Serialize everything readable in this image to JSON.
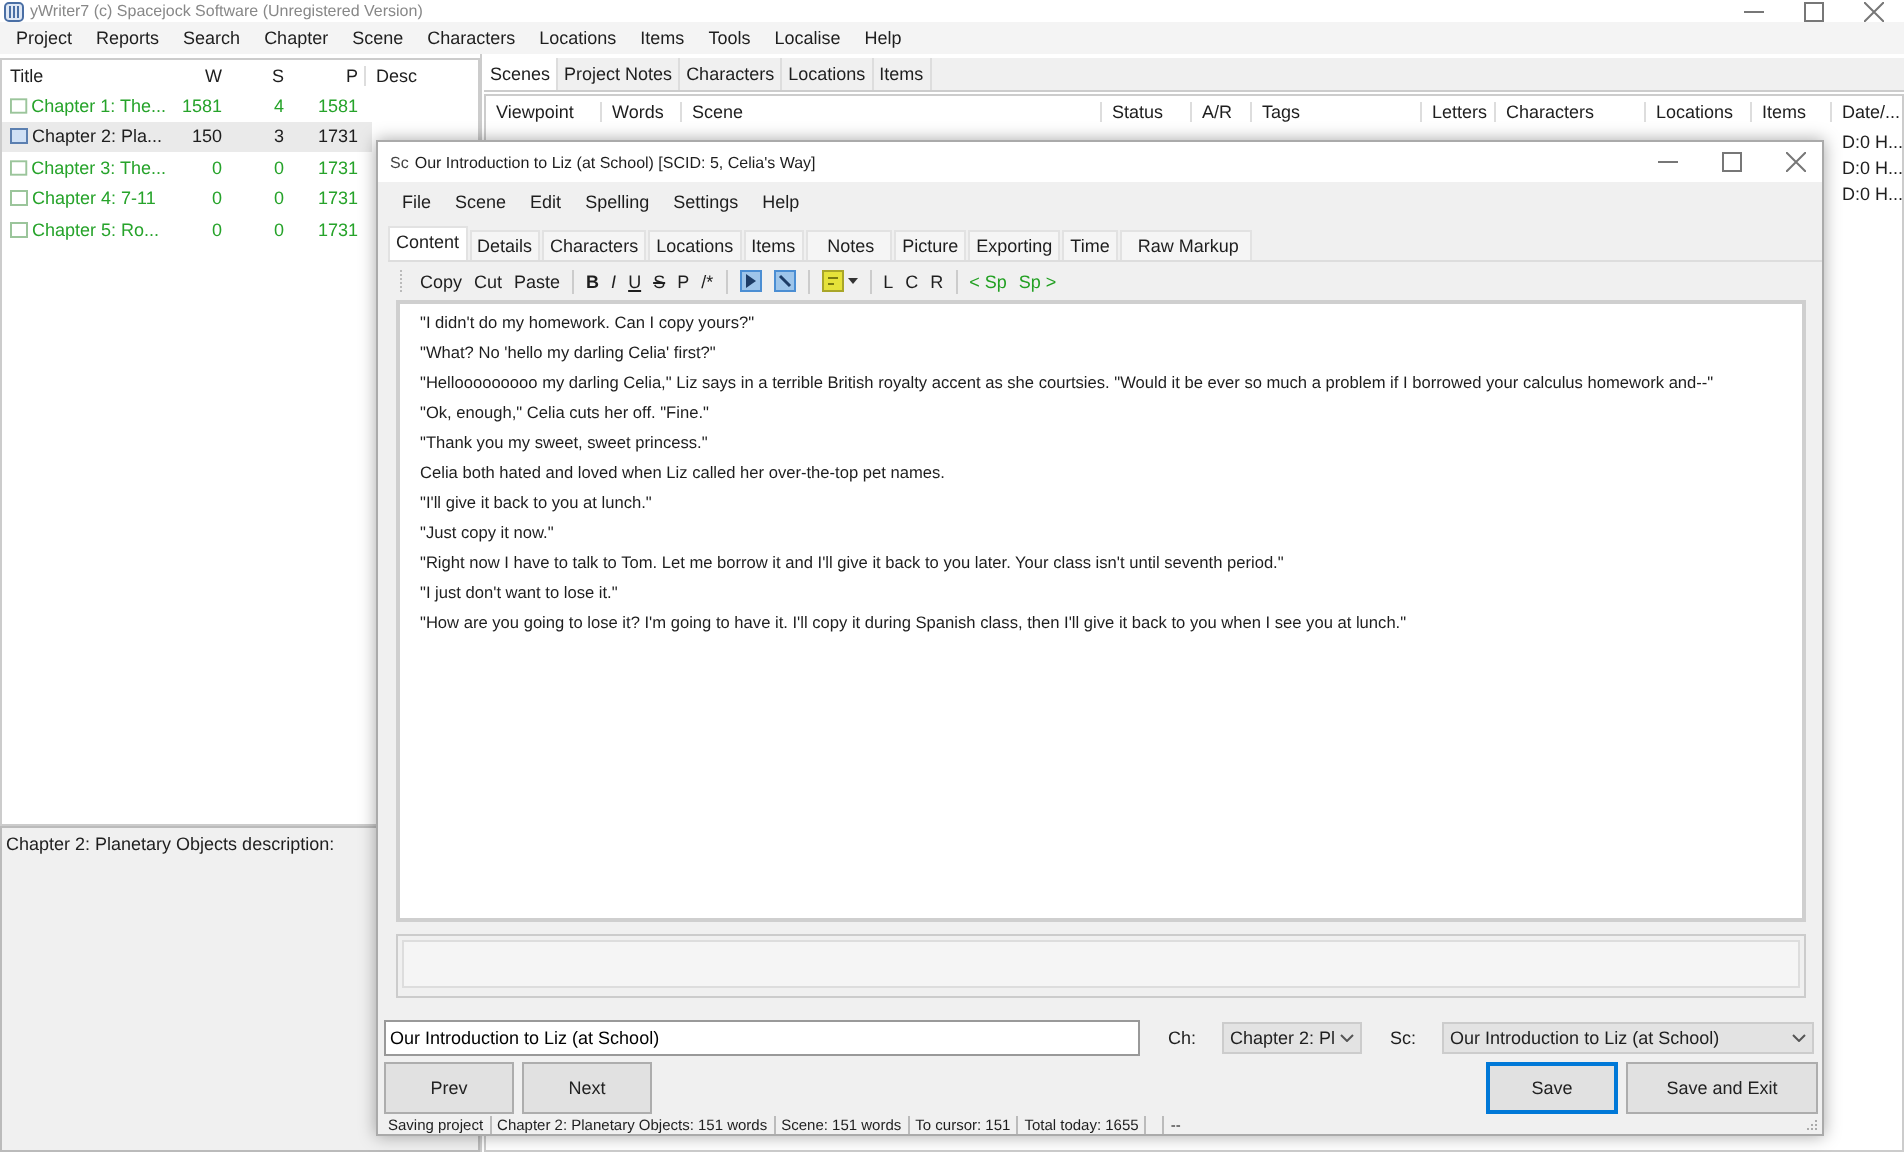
{
  "main_window": {
    "title": "yWriter7 (c) Spacejock Software (Unregistered Version)",
    "menu": [
      "Project",
      "Reports",
      "Search",
      "Chapter",
      "Scene",
      "Characters",
      "Locations",
      "Items",
      "Tools",
      "Localise",
      "Help"
    ]
  },
  "chapters": {
    "columns": [
      "Title",
      "W",
      "S",
      "P",
      "Desc"
    ],
    "rows": [
      {
        "title": "Chapter 1: The...",
        "w": "1581",
        "s": "4",
        "p": "1581",
        "selected": false
      },
      {
        "title": "Chapter 2: Pla...",
        "w": "150",
        "s": "3",
        "p": "1731",
        "selected": true
      },
      {
        "title": "Chapter 3: The...",
        "w": "0",
        "s": "0",
        "p": "1731",
        "selected": false
      },
      {
        "title": "Chapter 4: 7-11",
        "w": "0",
        "s": "0",
        "p": "1731",
        "selected": false
      },
      {
        "title": "Chapter 5: Ro...",
        "w": "0",
        "s": "0",
        "p": "1731",
        "selected": false
      }
    ]
  },
  "description": "Chapter 2: Planetary Objects description:",
  "tabs": [
    {
      "label": "Scenes",
      "selected": true
    },
    {
      "label": "Project Notes",
      "selected": false
    },
    {
      "label": "Characters",
      "selected": false
    },
    {
      "label": "Locations",
      "selected": false
    },
    {
      "label": "Items",
      "selected": false
    }
  ],
  "scenes": {
    "columns": [
      "Viewpoint",
      "Words",
      "Scene",
      "Status",
      "A/R",
      "Tags",
      "Letters",
      "Characters",
      "Locations",
      "Items",
      "Date/..."
    ],
    "rows": [
      {
        "date": "D:0 H..."
      },
      {
        "date": "D:0 H..."
      },
      {
        "date": "D:0 H..."
      }
    ]
  },
  "editor": {
    "icon_label": "Sc",
    "title": "Our Introduction to Liz (at School) [SCID: 5, Celia's Way]",
    "menu": [
      "File",
      "Scene",
      "Edit",
      "Spelling",
      "Settings",
      "Help"
    ],
    "tabs": [
      {
        "label": "Content",
        "selected": true
      },
      {
        "label": "Details",
        "selected": false
      },
      {
        "label": "Characters",
        "selected": false
      },
      {
        "label": "Locations",
        "selected": false
      },
      {
        "label": "Items",
        "selected": false
      },
      {
        "label": "Notes",
        "selected": false
      },
      {
        "label": "Picture",
        "selected": false
      },
      {
        "label": "Exporting",
        "selected": false
      },
      {
        "label": "Time",
        "selected": false
      },
      {
        "label": "Raw Markup",
        "selected": false
      }
    ],
    "toolbar": [
      [
        {
          "kind": "text",
          "label": "Copy"
        },
        {
          "kind": "text",
          "label": "Cut"
        },
        {
          "kind": "text",
          "label": "Paste"
        }
      ],
      [
        {
          "kind": "bold",
          "label": "B"
        },
        {
          "kind": "italic",
          "label": "I"
        },
        {
          "kind": "underline",
          "label": "U"
        },
        {
          "kind": "strike",
          "label": "S"
        },
        {
          "kind": "text",
          "label": "P"
        },
        {
          "kind": "text",
          "label": "/*"
        }
      ],
      [
        {
          "kind": "toggle",
          "pressed": true
        },
        {
          "kind": "toggle",
          "pressed": true
        }
      ],
      [
        {
          "kind": "highlight"
        }
      ],
      [
        {
          "kind": "text",
          "label": "L"
        },
        {
          "kind": "text",
          "label": "C"
        },
        {
          "kind": "text",
          "label": "R"
        }
      ],
      [
        {
          "kind": "link",
          "label": "< Sp"
        },
        {
          "kind": "link",
          "label": "Sp >"
        }
      ]
    ],
    "paragraphs": [
      "\"I didn't do my homework. Can I copy yours?\"",
      "\"What? No 'hello my darling Celia' first?\"",
      "\"Hellooooooooo my darling Celia,\" Liz says in a terrible British royalty accent as she courtsies. \"Would it be ever so much a problem if I borrowed your calculus homework and--\"",
      "\"Ok, enough,\" Celia cuts her off. \"Fine.\"",
      "\"Thank you my sweet, sweet princess.\"",
      "Celia both hated and loved when Liz called her over-the-top pet names.",
      "\"I'll give it back to you at lunch.\"",
      "\"Just copy it now.\"",
      "\"Right now I have to talk to Tom. Let me borrow it and I'll give it back to you later. Your class isn't until seventh period.\"",
      "\"I just don't want to lose it.\"",
      "\"How are you going to lose it? I'm going to have it. I'll copy it during Spanish class, then I'll give it back to you when I see you at lunch.\""
    ],
    "scene_name": "Our Introduction to Liz (at School)",
    "chapter_label": "Ch:",
    "chapter_value": "Chapter 2: Pl",
    "scene_label": "Sc:",
    "scene_value": "Our Introduction to Liz (at School)",
    "nav_buttons": [
      "Prev",
      "Next"
    ],
    "buttons": [
      {
        "label": "Save",
        "default": true
      },
      {
        "label": "Save and Exit",
        "default": false
      }
    ],
    "status_bar": [
      "Saving project",
      "Chapter 2: Planetary Objects: 151 words",
      "Scene: 151 words",
      "To cursor: 151",
      "Total today: 1655",
      "--"
    ]
  }
}
